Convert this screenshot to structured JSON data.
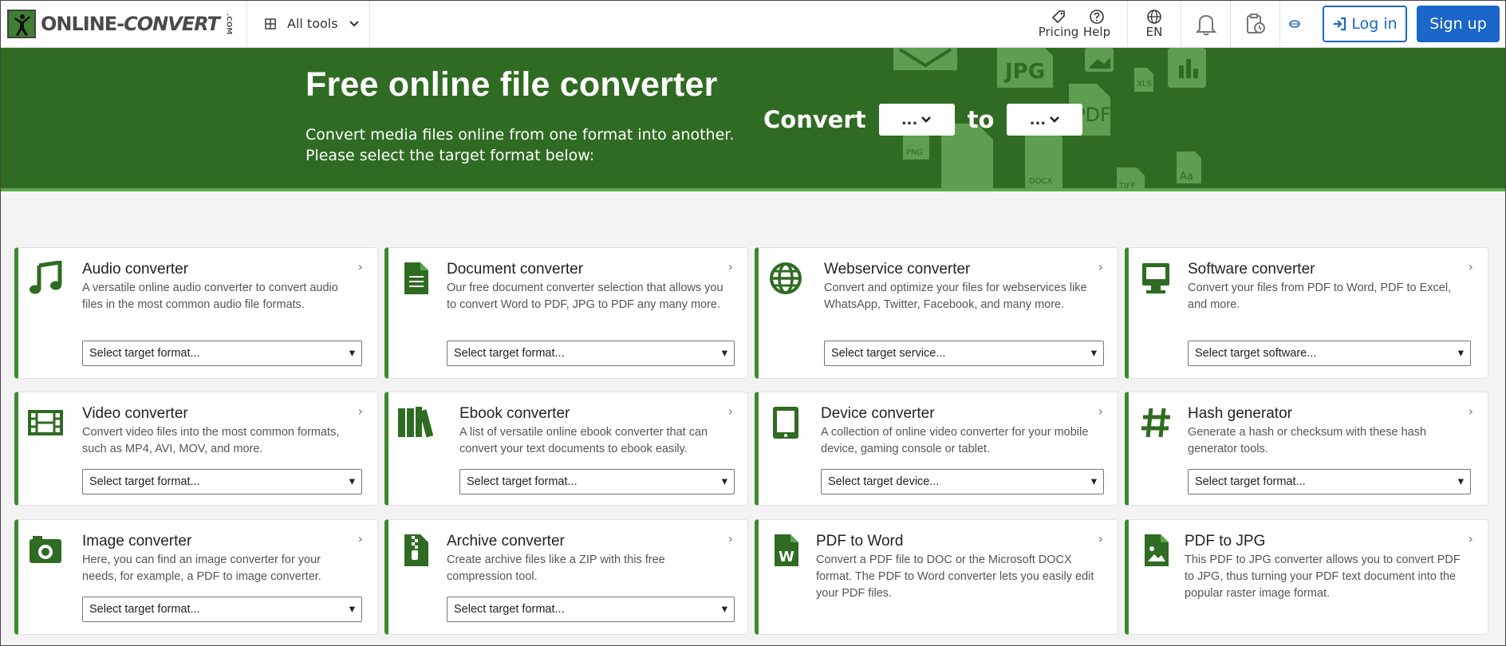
{
  "header": {
    "logo_main": "ONLINE-",
    "logo_italic": "CONVERT",
    "logo_com": ".COM",
    "all_tools": "All tools",
    "pricing": "Pricing",
    "help": "Help",
    "language": "EN",
    "login": "Log in",
    "signup": "Sign up"
  },
  "hero": {
    "title": "Free online file converter",
    "subtitle": "Convert media files online from one format into another. Please select the target format below:",
    "convert_label": "Convert",
    "to_label": "to",
    "from_value": "...",
    "to_value": "...",
    "deco_labels": [
      "JPG",
      "PDF",
      "XLS",
      "PNG",
      "DOCX",
      "TIFF",
      "Aa"
    ]
  },
  "colors": {
    "brand_green": "#2f6b22",
    "accent_green": "#3c8a2e",
    "primary_blue": "#1a66c9"
  },
  "cards": [
    {
      "title": "Audio converter",
      "desc": "A versatile online audio converter to convert audio files in the most common audio file formats.",
      "select": "Select target format...",
      "icon": "music-note-icon"
    },
    {
      "title": "Document converter",
      "desc": "Our free document converter selection that allows you to convert Word to PDF, JPG to PDF any many more.",
      "select": "Select target format...",
      "icon": "document-icon"
    },
    {
      "title": "Webservice converter",
      "desc": "Convert and optimize your files for webservices like WhatsApp, Twitter, Facebook, and many more.",
      "select": "Select target service...",
      "icon": "globe-icon"
    },
    {
      "title": "Software converter",
      "desc": "Convert your files from PDF to Word, PDF to Excel, and more.",
      "select": "Select target software...",
      "icon": "desktop-icon"
    },
    {
      "title": "Video converter",
      "desc": "Convert video files into the most common formats, such as MP4, AVI, MOV, and more.",
      "select": "Select target format...",
      "icon": "film-icon"
    },
    {
      "title": "Ebook converter",
      "desc": "A list of versatile online ebook converter that can convert your text documents to ebook easily.",
      "select": "Select target format...",
      "icon": "books-icon"
    },
    {
      "title": "Device converter",
      "desc": "A collection of online video converter for your mobile device, gaming console or tablet.",
      "select": "Select target device...",
      "icon": "tablet-icon"
    },
    {
      "title": "Hash generator",
      "desc": "Generate a hash or checksum with these hash generator tools.",
      "select": "Select target format...",
      "icon": "hash-icon"
    },
    {
      "title": "Image converter",
      "desc": "Here, you can find an image converter for your needs, for example, a PDF to image converter.",
      "select": "Select target format...",
      "icon": "camera-icon"
    },
    {
      "title": "Archive converter",
      "desc": "Create archive files like a ZIP with this free compression tool.",
      "select": "Select target format...",
      "icon": "archive-icon"
    },
    {
      "title": "PDF to Word",
      "desc": "Convert a PDF file to DOC or the Microsoft DOCX format. The PDF to Word converter lets you easily edit your PDF files.",
      "icon": "word-file-icon"
    },
    {
      "title": "PDF to JPG",
      "desc": "This PDF to JPG converter allows you to convert PDF to JPG, thus turning your PDF text document into the popular raster image format.",
      "icon": "image-file-icon"
    }
  ]
}
